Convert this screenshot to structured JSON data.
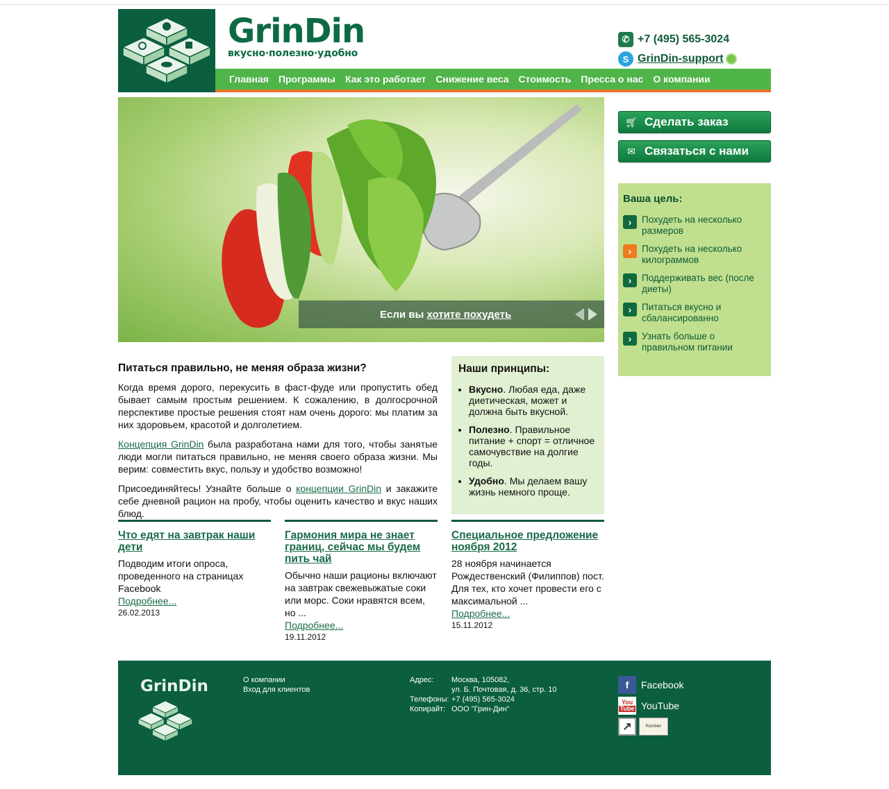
{
  "header": {
    "brand_name": "GrinDin",
    "tagline": "вкусно·полезно·удобно",
    "phone": "+7 (495) 565-3024",
    "skype": "GrinDin-support"
  },
  "nav": [
    "Главная",
    "Программы",
    "Как это работает",
    "Снижение веса",
    "Стоимость",
    "Пресса о нас",
    "О компании"
  ],
  "hero": {
    "caption_prefix": "Если вы ",
    "caption_link": "хотите похудеть"
  },
  "actions": {
    "order": "Сделать заказ",
    "contact": "Связаться с нами"
  },
  "goals": {
    "title": "Ваша цель:",
    "items": [
      "Похудеть на несколько размеров",
      "Похудеть на несколько килограммов",
      "Поддерживать вес (после диеты)",
      "Питаться вкусно и сбалансированно",
      "Узнать больше о правильном питании"
    ]
  },
  "intro": {
    "title": "Питаться правильно, не меняя образа жизни?",
    "p1": "Когда время дорого, перекусить в фаст-фуде или пропустить обед бывает самым простым решением. К сожалению, в долгосрочной перспективе простые решения стоят нам очень дорого: мы платим за них здоровьем, красотой и долголетием.",
    "p2_link": "Концепция GrinDin",
    "p2_rest": " была разработана нами для того, чтобы занятые люди могли питаться правильно, не меняя своего образа жизни. Мы верим: совместить вкус, пользу и удобство возможно!",
    "p3_start": "Присоединяйтесь! Узнайте больше о ",
    "p3_link": "концепции GrinDin",
    "p3_end": " и закажите себе дневной рацион на пробу, чтобы оценить качество и вкус наших блюд."
  },
  "principles": {
    "title": "Наши принципы:",
    "items": [
      {
        "bold": "Вкусно",
        "text": ". Любая еда, даже диетическая, может и должна быть вкусной."
      },
      {
        "bold": "Полезно",
        "text": ". Правильное питание + спорт = отличное самочувствие на долгие годы."
      },
      {
        "bold": "Удобно",
        "text": ". Мы делаем вашу жизнь немного проще."
      }
    ]
  },
  "news": [
    {
      "title": "Что едят на завтрак наши дети",
      "text": "Подводим итоги опроса, проведенного на страницах Facebook",
      "more": "Подробнее...",
      "date": "26.02.2013"
    },
    {
      "title": "Гармония мира не знает границ, сейчас мы будем пить чай",
      "text": "Обычно наши рационы включают на завтрак свежевыжатые соки или морс. Соки нравятся всем, но ...",
      "more": "Подробнее...",
      "date": "19.11.2012"
    },
    {
      "title": "Специальное предложение ноября 2012",
      "text": "28 ноября начинается Рождественский (Филиппов) пост. Для тех, кто хочет провести его с максимальной ...",
      "more": "Подробнее...",
      "date": "15.11.2012"
    }
  ],
  "footer": {
    "brand": "GrinDin",
    "links": [
      "О компании",
      "Вход для клиентов"
    ],
    "address_label": "Адрес:",
    "address_line1": "Москва, 105082,",
    "address_line2": "ул. Б. Почтовая, д. 36, стр. 10",
    "phones_label": "Телефоны:",
    "phones": "+7 (495) 565-3024",
    "copyright_label": "Копирайт:",
    "copyright": "ООО \"Грин-Дин\"",
    "social": [
      "Facebook",
      "YouTube"
    ]
  }
}
